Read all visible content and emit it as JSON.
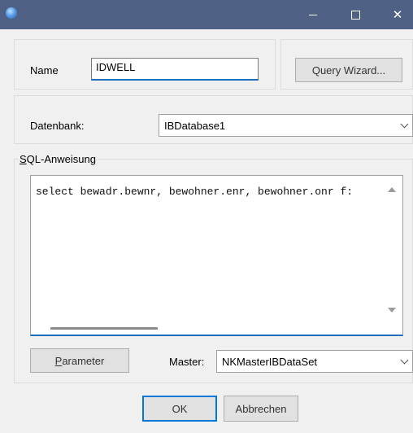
{
  "window": {
    "minimize_glyph": "–",
    "maximize_glyph": "□",
    "close_glyph": "✕"
  },
  "name": {
    "label": "Name",
    "value": "IDWELL"
  },
  "query_wizard": {
    "label": "Query Wizard..."
  },
  "database": {
    "label": "Datenbank:",
    "value": "IBDatabase1"
  },
  "sql": {
    "legend_first": "S",
    "legend_rest": "QL-Anweisung",
    "text": "select bewadr.bewnr, bewohner.enr, bewohner.onr f:"
  },
  "parameter": {
    "label_first": "P",
    "label_rest": "arameter"
  },
  "master": {
    "label": "Master:",
    "value": "NKMasterIBDataSet"
  },
  "buttons": {
    "ok": "OK",
    "cancel": "Abbrechen"
  },
  "colors": {
    "titlebar": "#4f6085",
    "focus_underline": "#1e6fbd",
    "window_bg": "#f0f0f0"
  }
}
